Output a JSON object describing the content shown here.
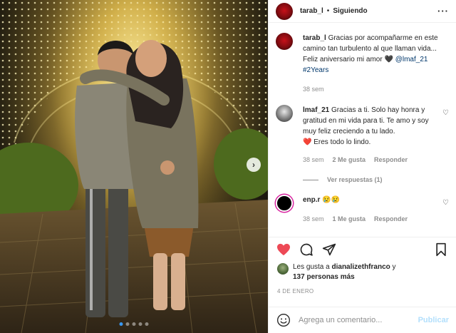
{
  "header": {
    "username": "tarab_l",
    "separator": "•",
    "follow_status": "Siguiendo",
    "more": "···"
  },
  "caption": {
    "username": "tarab_l",
    "text": "Gracias por acompañarme en este camino tan turbulento al que llaman vida... Feliz aniversario mi amor",
    "emoji": "🖤",
    "mention": "@lmaf_21",
    "hashtag": "#2Years",
    "time": "38 sem"
  },
  "comments": [
    {
      "username": "lmaf_21",
      "text": "Gracias a ti. Solo hay honra y gratitud en mi vida para ti. Te amo y soy muy feliz creciendo a tu lado.",
      "text2": "Eres todo lo lindo.",
      "heart_emoji": "❤️",
      "time": "38 sem",
      "likes": "2 Me gusta",
      "reply": "Responder",
      "view_replies": "Ver respuestas (1)"
    },
    {
      "username": "enp.r",
      "text": "😢😢",
      "time": "38 sem",
      "likes": "1 Me gusta",
      "reply": "Responder"
    }
  ],
  "likes": {
    "prefix": "Les gusta a",
    "user": "dianalizethfranco",
    "joiner": "y",
    "others": "137 personas más"
  },
  "date": "4 DE ENERO",
  "add_comment": {
    "placeholder": "Agrega un comentario...",
    "post_label": "Publicar"
  },
  "carousel": {
    "count": 5,
    "active_index": 0
  },
  "colors": {
    "like_red": "#ed4956",
    "link_blue": "#00376b",
    "post_disabled": "#b2dffc",
    "dot_active": "#3897f0"
  },
  "icons": {
    "like": "heart-filled-icon",
    "comment": "comment-bubble-icon",
    "share": "paper-plane-icon",
    "save": "bookmark-icon",
    "emoji": "smiley-icon",
    "next": "chevron-right-icon"
  }
}
